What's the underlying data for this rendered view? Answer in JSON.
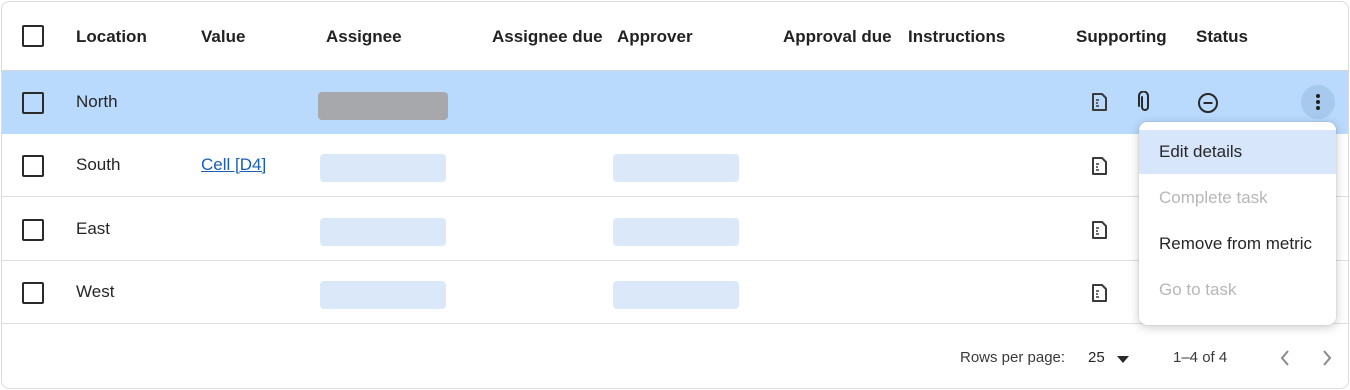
{
  "table": {
    "columns": [
      "Location",
      "Value",
      "Assignee",
      "Assignee due",
      "Approver",
      "Approval due",
      "Instructions",
      "Supporting",
      "Status"
    ],
    "rows": [
      {
        "location": "North",
        "value": ""
      },
      {
        "location": "South",
        "value": "Cell [D4]"
      },
      {
        "location": "East",
        "value": ""
      },
      {
        "location": "West",
        "value": ""
      }
    ]
  },
  "icons": {
    "document": "document-icon",
    "attachment": "paperclip-icon",
    "status": "minus-circle-icon",
    "more": "more-vert-icon",
    "dropdown": "arrow-drop-down-icon",
    "prev": "chevron-left-icon",
    "next": "chevron-right-icon"
  },
  "menu": {
    "items": [
      {
        "label": "Edit details",
        "disabled": false
      },
      {
        "label": "Complete task",
        "disabled": true
      },
      {
        "label": "Remove from metric",
        "disabled": false
      },
      {
        "label": "Go to task",
        "disabled": true
      }
    ]
  },
  "pagination": {
    "rows_per_page_label": "Rows per page:",
    "rows_per_page_value": "25",
    "range": "1–4 of 4"
  },
  "colors": {
    "selected_row": "#b9d9fd",
    "placeholder": "#dbe8fa",
    "link": "#1a5fb4"
  }
}
